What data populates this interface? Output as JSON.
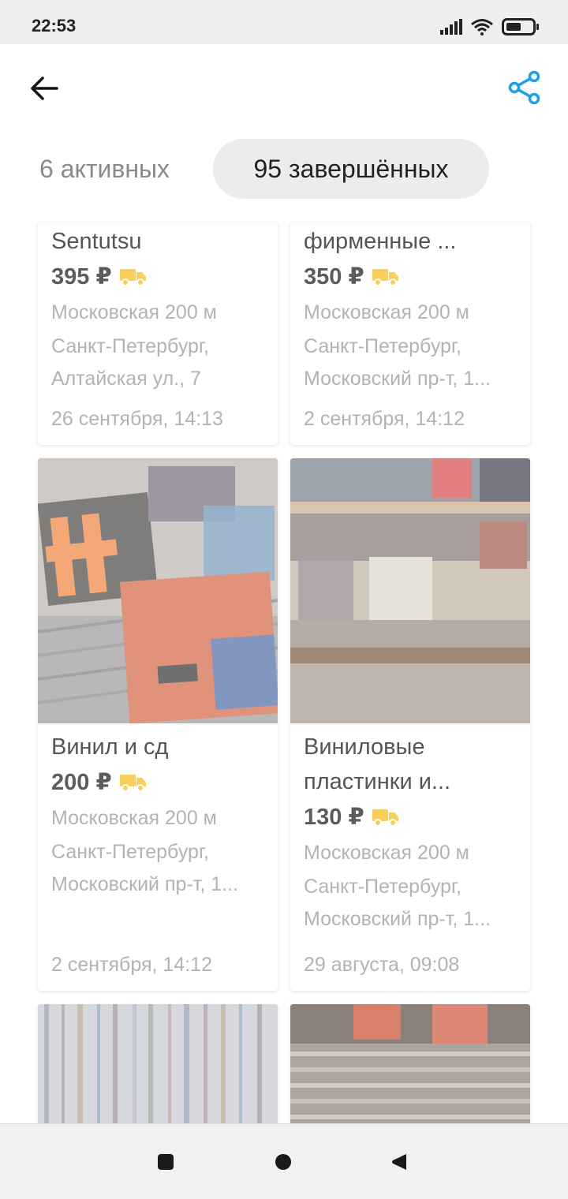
{
  "status": {
    "time": "22:53"
  },
  "tabs": {
    "active_label": "6 активных",
    "done_label": "95 завершённых"
  },
  "listings": [
    {
      "title": "Sentutsu",
      "price": "395 ₽",
      "metro": "Московская 200 м",
      "address_line1": "Санкт-Петербург,",
      "address_line2": "Алтайская ул., 7",
      "date": "26 сентября, 14:13"
    },
    {
      "title": "фирменные ...",
      "price": "350 ₽",
      "metro": "Московская 200 м",
      "address_line1": "Санкт-Петербург,",
      "address_line2": "Московский пр-т, 1...",
      "date": "2 сентября, 14:12"
    },
    {
      "title": "Винил и сд",
      "price": "200 ₽",
      "metro": "Московская 200 м",
      "address_line1": "Санкт-Петербург,",
      "address_line2": "Московский пр-т, 1...",
      "date": "2 сентября, 14:12"
    },
    {
      "title_line1": "Виниловые",
      "title_line2": "пластинки и...",
      "price": "130 ₽",
      "metro": "Московская 200 м",
      "address_line1": "Санкт-Петербург,",
      "address_line2": "Московский пр-т, 1...",
      "date": "29 августа, 09:08"
    }
  ],
  "icons": {
    "back": "arrow-left-icon",
    "share": "share-icon",
    "delivery": "truck-icon",
    "signal": "signal-icon",
    "wifi": "wifi-icon",
    "battery": "battery-icon"
  },
  "colors": {
    "share_accent": "#1aa0e6",
    "delivery_accent": "#f8cf5a"
  }
}
